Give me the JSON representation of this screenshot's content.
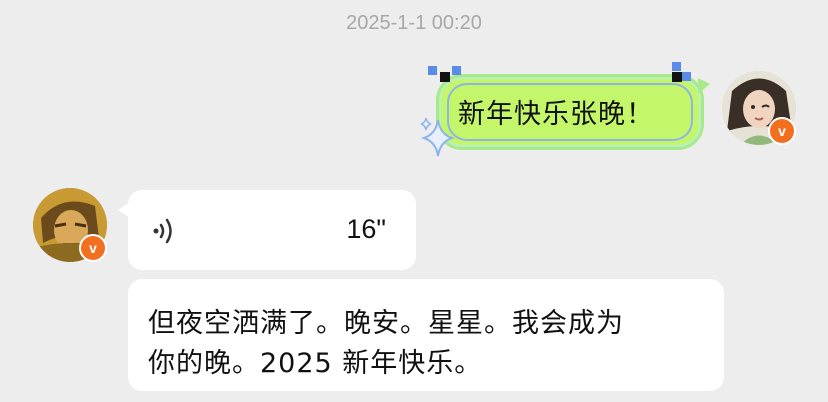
{
  "chat": {
    "timestamp": "2025-1-1 00:20",
    "sent_message": "新年快乐张晚！",
    "received_voice": {
      "duration": "16\""
    },
    "received_text": {
      "line1": "但夜空洒满了。晚安。星星。我会成为",
      "line2": "你的晚。2025 新年快乐。"
    },
    "badge_letter": "v"
  },
  "colors": {
    "background": "#ededed",
    "sent_bubble": "#c4f66a",
    "received_bubble": "#ffffff",
    "badge": "#f36f20"
  },
  "icons": [
    "voice-wave-icon",
    "sparkle-icon",
    "verified-badge-icon"
  ]
}
